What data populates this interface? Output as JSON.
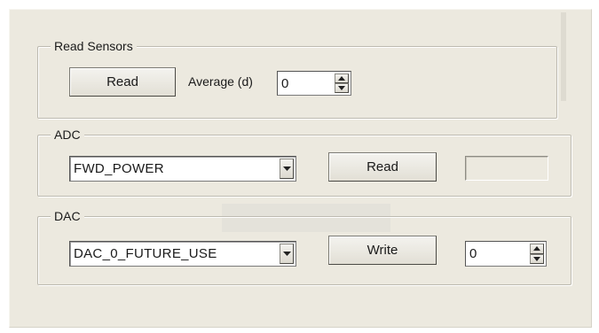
{
  "read_sensors": {
    "title": "Read Sensors",
    "read_label": "Read",
    "average_label": "Average (d)",
    "average_value": "0"
  },
  "adc": {
    "title": "ADC",
    "channel_selected": "FWD_POWER",
    "read_label": "Read",
    "result_value": ""
  },
  "dac": {
    "title": "DAC",
    "channel_selected": "DAC_0_FUTURE_USE",
    "write_label": "Write",
    "value": "0"
  }
}
